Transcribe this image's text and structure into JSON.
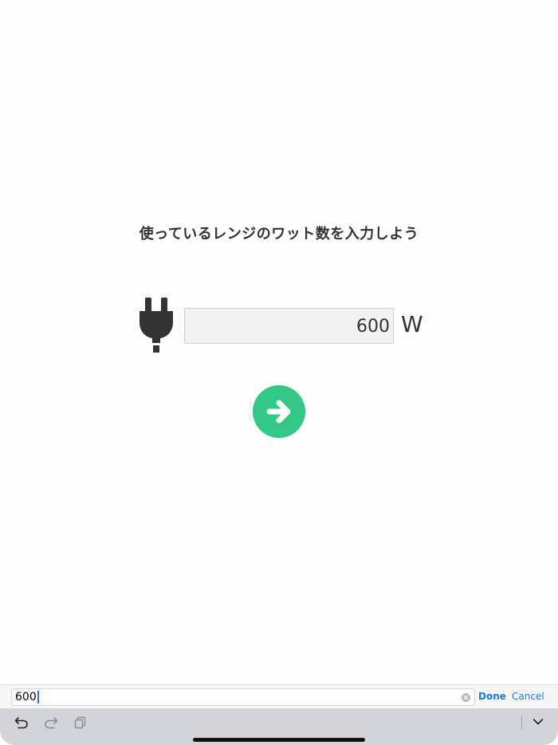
{
  "main": {
    "prompt": "使っているレンジのワット数を入力しよう",
    "watt_value": "600",
    "unit": "W",
    "icons": {
      "plug": "plug-icon",
      "next": "arrow-right-circle-icon"
    },
    "accent_color": "#33c887"
  },
  "keyboard_accessory": {
    "input_value": "600",
    "done_label": "Done",
    "cancel_label": "Cancel",
    "link_color": "#1a7be8"
  },
  "shortcut_bar": {
    "icons": [
      "undo-icon",
      "redo-icon",
      "paste-icon",
      "keyboard-dismiss-icon"
    ]
  }
}
